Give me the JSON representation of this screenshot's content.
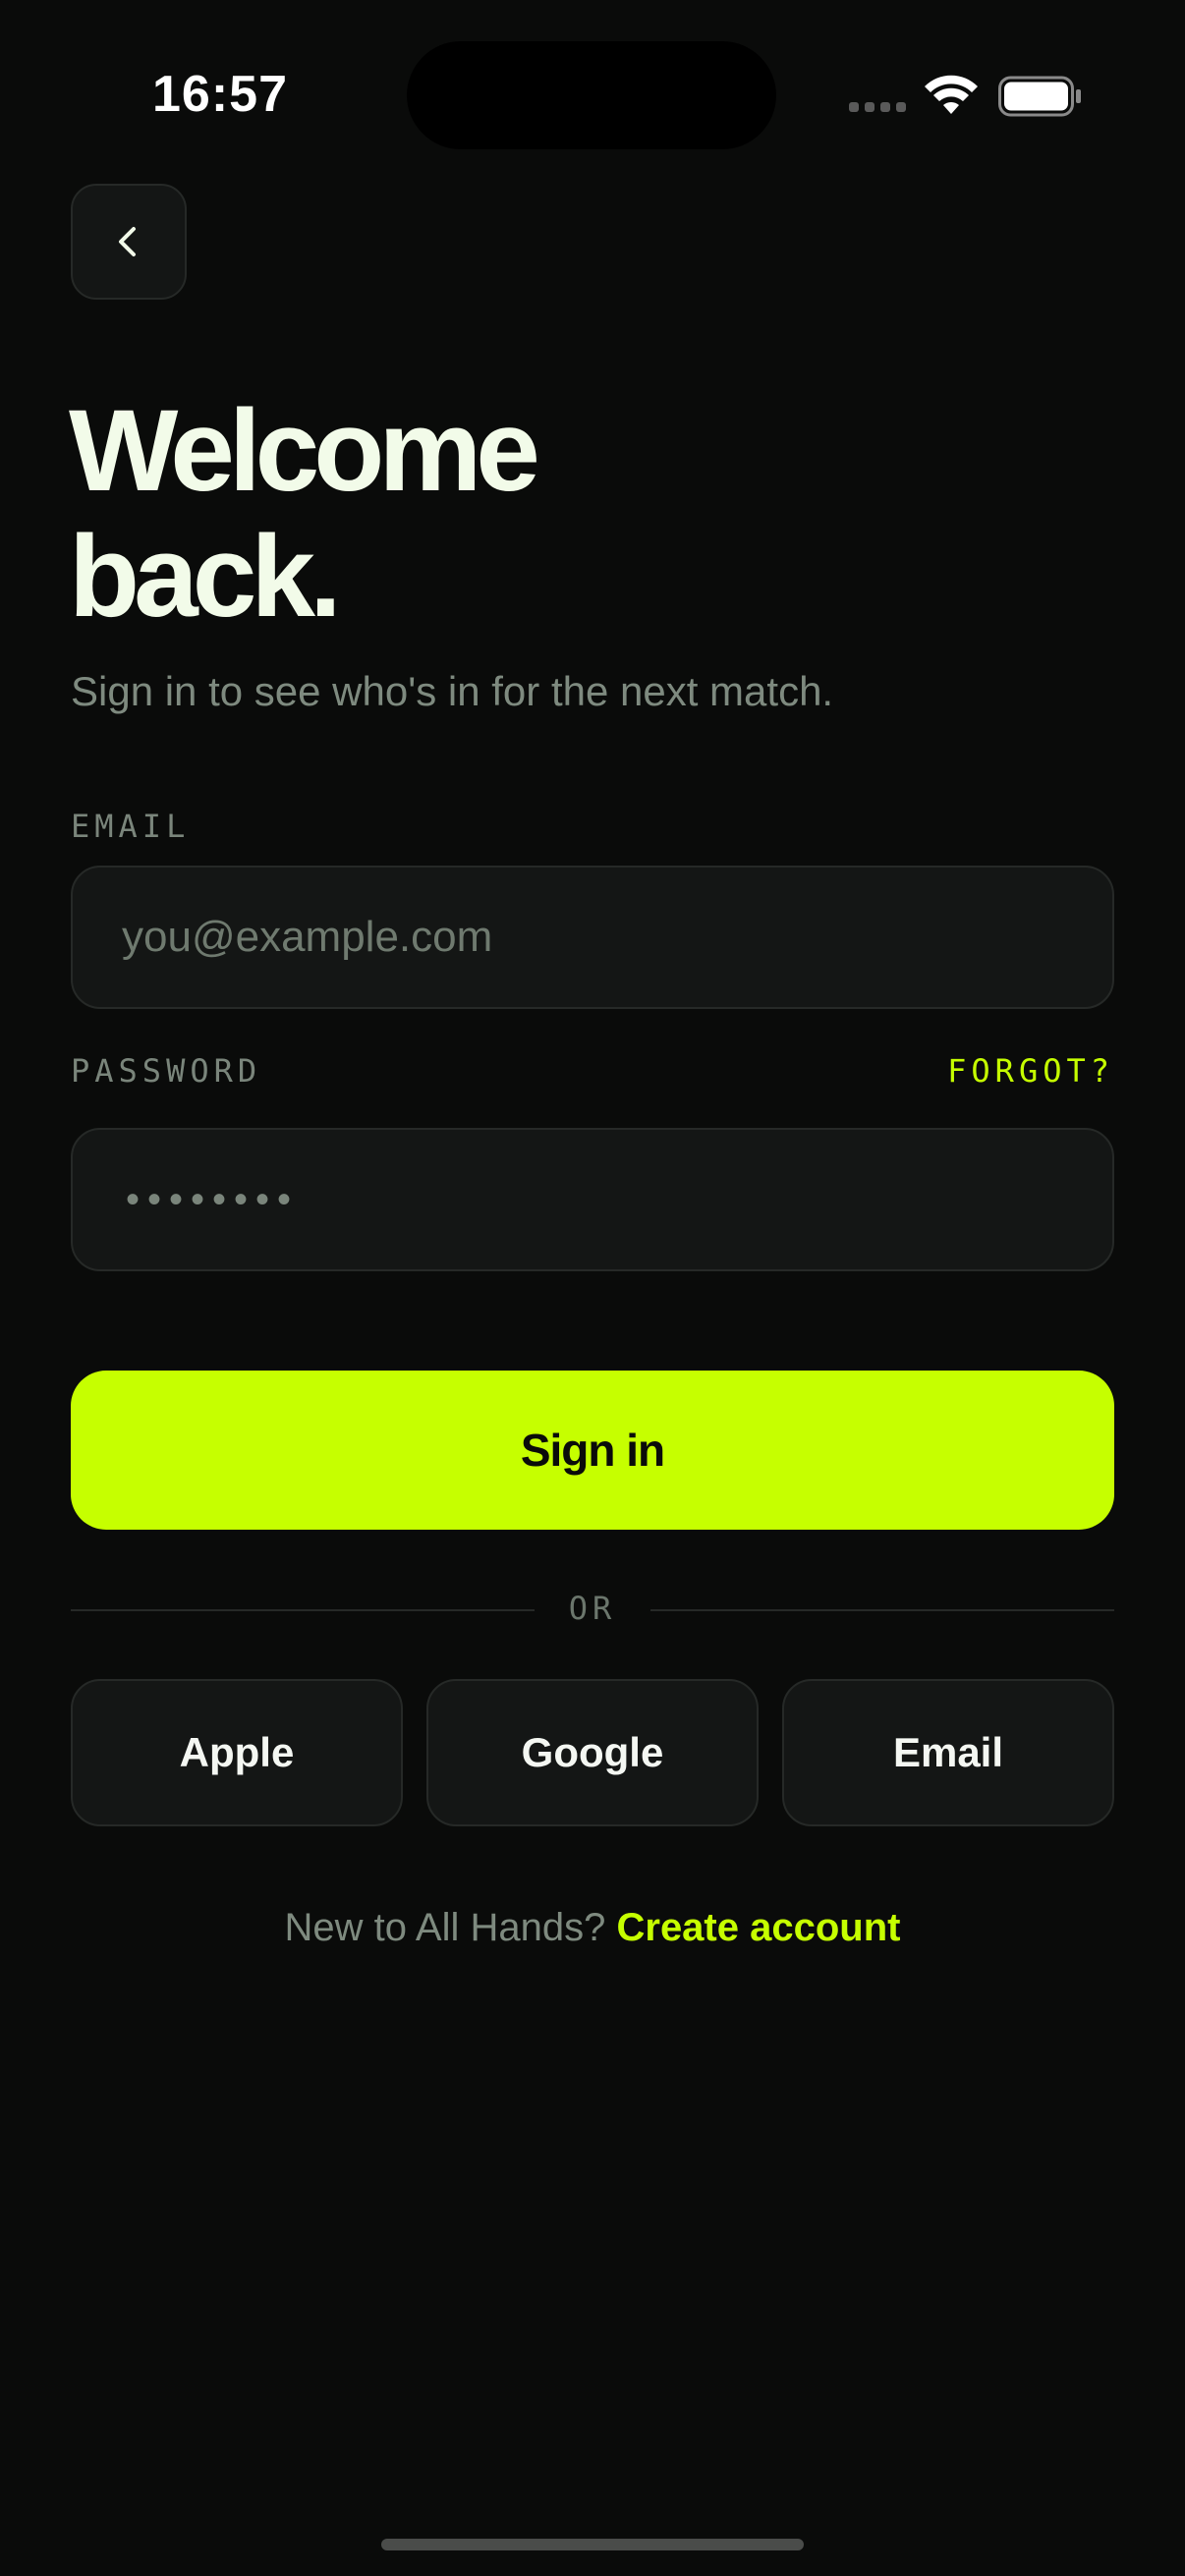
{
  "status_bar": {
    "time": "16:57"
  },
  "header": {
    "back_icon": "chevron-left-icon",
    "title_line1": "Welcome",
    "title_line2": "back.",
    "subtitle": "Sign in to see who's in for the next match."
  },
  "form": {
    "email_label": "EMAIL",
    "email_placeholder": "you@example.com",
    "email_value": "",
    "password_label": "PASSWORD",
    "forgot_label": "FORGOT?",
    "password_masked": "••••••••",
    "submit_label": "Sign in"
  },
  "divider": {
    "label": "OR"
  },
  "social": {
    "apple_label": "Apple",
    "google_label": "Google",
    "email_label": "Email"
  },
  "footer": {
    "prompt": "New to All Hands?",
    "link_label": "Create account"
  },
  "colors": {
    "background": "#0a0b0a",
    "accent": "#c6ff00",
    "surface": "#141615",
    "border": "#262927",
    "muted_text": "#7e8a7f",
    "title_text": "#f2fbe9"
  }
}
